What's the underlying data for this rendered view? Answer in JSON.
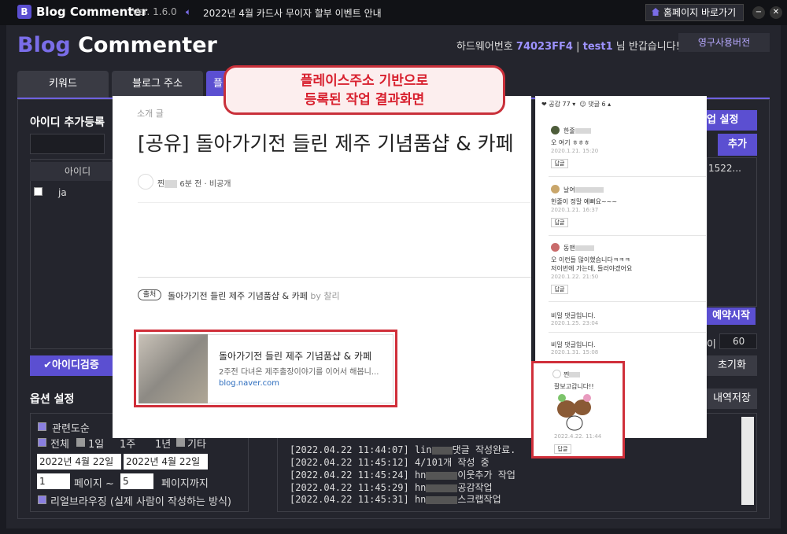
{
  "titlebar": {
    "logo": "B",
    "title": "Blog Commenter",
    "version": "Ver. 1.6.0",
    "notice": "2022년 4월 카드사 무이자 할부 이벤트 안내",
    "home_btn": "홈페이지 바로가기",
    "min": "−",
    "close": "✕"
  },
  "header": {
    "brand_a": "Blog",
    "brand_b": " Commenter",
    "hw_label": "하드웨어번호",
    "hw_code": "74023FF4",
    "sep": "|",
    "user": "test1",
    "greet": "님 반갑습니다!",
    "perm_btn": "영구사용버전"
  },
  "tabs": [
    "키워드",
    "블로그 주소",
    "플"
  ],
  "left": {
    "section_id": "아이디 추가등록",
    "col_id": "아이디",
    "row_id": "ja",
    "verify_btn": "아이디검증",
    "section_opt": "옵션 설정"
  },
  "options": {
    "cat": "관련도순",
    "all": "전체",
    "d1": "1일",
    "w1": "1주",
    "y1": "1년",
    "etc": "기타",
    "date1": "2022년  4월 22일",
    "date2": "2022년  4월 22일",
    "page_from": "1",
    "page_sep": "페이지 ~",
    "page_to": "5",
    "page_end": "페이지까지",
    "real": "리얼브라우징 (실제 사람이 작성하는 방식)"
  },
  "right": {
    "setting_btn": "업 설정",
    "add_btn": "추가",
    "trail": "1522...",
    "reserve_btn": "예약시작",
    "count_label": "이",
    "count": "60",
    "reset_btn": "초기화",
    "save_btn": "내역저장"
  },
  "log": [
    {
      "t": "[2022.04.22 11:44:07]",
      "u": "lin",
      "m": "댓글 작성완료."
    },
    {
      "t": "[2022.04.22 11:45:12]",
      "u": "",
      "m": "4/101개 작성 중"
    },
    {
      "t": "[2022.04.22 11:45:24]",
      "u": "hn",
      "m": "이웃추가 작업"
    },
    {
      "t": "[2022.04.22 11:45:29]",
      "u": "hn",
      "m": "공감작업"
    },
    {
      "t": "[2022.04.22 11:45:31]",
      "u": "hn",
      "m": "스크랩작업"
    }
  ],
  "callout": {
    "line1": "플레이스주소 기반으로",
    "line2": "등록된 작업 결과화면"
  },
  "post": {
    "category": "소개 글",
    "title": "[공유] 돌아가기전 들린 제주 기념품샵 & 카페",
    "author": "찐",
    "meta": "6분 전 · 비공개",
    "src_badge": "출처",
    "src_text": "돌아가기전 들린 제주 기념품샵 & 카페",
    "src_by": "by 찰리",
    "card_title": "돌아가기전 들린 제주 기념품샵 & 카페",
    "card_desc": "2주전 다녀온 제주출장이야기를 이어서 해봅니...",
    "card_url": "blog.naver.com"
  },
  "comments": {
    "like": "공감 77",
    "count": "댓글 6",
    "items": [
      {
        "name": "한줄",
        "text": "오 여기 ㅎㅎㅎ",
        "date": "2020.1.21. 15:20",
        "color": "#4d5c3a"
      },
      {
        "name": "날여",
        "text": "헌줄이 정말 예뻐요~~~",
        "date": "2020.1.21. 16:37",
        "color": "#c9a66b"
      },
      {
        "name": "동맨",
        "text": "오 이런들 많이했습니다ㅋㅋㅋ",
        "text2": "저이번에 가는데, 들러야겠어요",
        "date": "2020.1.22. 21:50",
        "color": "#c96b6b"
      },
      {
        "name": "",
        "text": "비밀 댓글입니다.",
        "date": "2020.1.25. 23:04"
      },
      {
        "name": "",
        "text": "비밀 댓글입니다.",
        "date": "2020.1.31. 15:08"
      },
      {
        "name": "찐",
        "text": "잘보고갑니다!!",
        "date": "2022.4.22. 11:44"
      }
    ],
    "reply": "답글"
  }
}
